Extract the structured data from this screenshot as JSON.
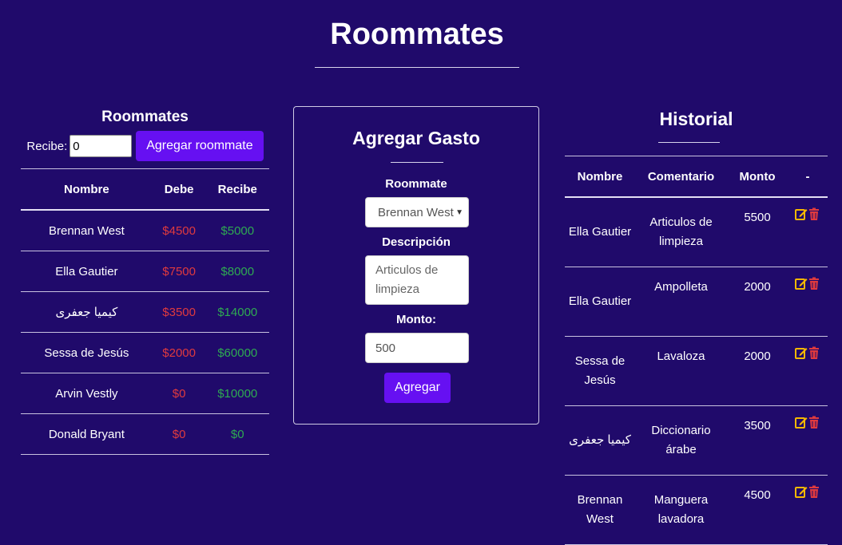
{
  "header": {
    "title": "Roommates"
  },
  "roommates_panel": {
    "title": "Roommates",
    "recibe_label": "Recibe:",
    "recibe_value": "0",
    "add_button": "Agregar roommate",
    "columns": [
      "Nombre",
      "Debe",
      "Recibe"
    ],
    "rows": [
      {
        "nombre": "Brennan West",
        "debe": "$4500",
        "recibe": "$5000"
      },
      {
        "nombre": "Ella Gautier",
        "debe": "$7500",
        "recibe": "$8000"
      },
      {
        "nombre": "كيميا جعفرى",
        "debe": "$3500",
        "recibe": "$14000"
      },
      {
        "nombre": "Sessa de Jesús",
        "debe": "$2000",
        "recibe": "$60000"
      },
      {
        "nombre": "Arvin Vestly",
        "debe": "$0",
        "recibe": "$10000"
      },
      {
        "nombre": "Donald Bryant",
        "debe": "$0",
        "recibe": "$0"
      }
    ]
  },
  "gasto_form": {
    "title": "Agregar Gasto",
    "roommate_label": "Roommate",
    "roommate_selected": "Brennan West",
    "descripcion_label": "Descripción",
    "descripcion_value": "Articulos de limpieza",
    "monto_label": "Monto:",
    "monto_value": "500",
    "submit_button": "Agregar"
  },
  "historial": {
    "title": "Historial",
    "columns": [
      "Nombre",
      "Comentario",
      "Monto",
      "-"
    ],
    "rows": [
      {
        "nombre": "Ella Gautier",
        "comentario": "Articulos de limpieza",
        "monto": "5500"
      },
      {
        "nombre": "Ella Gautier",
        "comentario": "Ampolleta",
        "monto": "2000"
      },
      {
        "nombre": "Sessa de Jesús",
        "comentario": "Lavaloza",
        "monto": "2000"
      },
      {
        "nombre": "كيميا جعفرى",
        "comentario": "Diccionario árabe",
        "monto": "3500"
      },
      {
        "nombre": "Brennan West",
        "comentario": "Manguera lavadora",
        "monto": "4500"
      }
    ]
  },
  "colors": {
    "background": "#200a6b",
    "primary_button": "#6610f2",
    "debe": "#e03a3e",
    "recibe": "#2eaa52",
    "edit_icon": "#f5b800",
    "trash_icon": "#e03a3e"
  },
  "icons": {
    "edit": "edit-icon",
    "delete": "trash-icon"
  }
}
